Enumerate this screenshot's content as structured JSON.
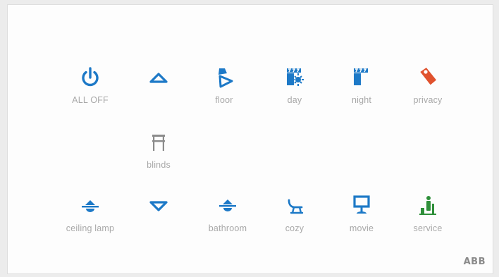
{
  "colors": {
    "accent": "#1d79c7",
    "privacy": "#e0522e",
    "service": "#2f8f3a",
    "blinds": "#8c8c8c",
    "label": "#a9a9a9"
  },
  "buttons": {
    "all_off": {
      "label": "ALL OFF",
      "icon": "power-icon"
    },
    "up": {
      "label": "",
      "icon": "arrow-up-icon"
    },
    "floor": {
      "label": "floor",
      "icon": "floor-lamp-icon"
    },
    "day": {
      "label": "day",
      "icon": "scene-day-icon"
    },
    "night": {
      "label": "night",
      "icon": "scene-night-icon"
    },
    "privacy": {
      "label": "privacy",
      "icon": "door-hanger-icon"
    },
    "blinds": {
      "label": "blinds",
      "icon": "blinds-icon"
    },
    "ceiling_lamp": {
      "label": "ceiling lamp",
      "icon": "ceiling-lamp-icon"
    },
    "down": {
      "label": "",
      "icon": "arrow-down-icon"
    },
    "bathroom": {
      "label": "bathroom",
      "icon": "bathroom-lamp-icon"
    },
    "cozy": {
      "label": "cozy",
      "icon": "lounge-chair-icon"
    },
    "movie": {
      "label": "movie",
      "icon": "projector-screen-icon"
    },
    "service": {
      "label": "service",
      "icon": "service-icon"
    }
  },
  "brand": "ABB"
}
